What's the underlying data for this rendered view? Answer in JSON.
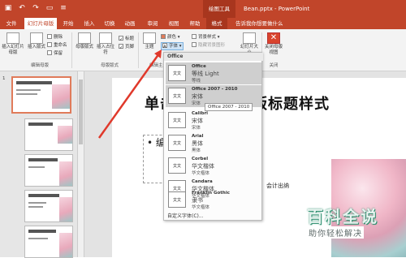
{
  "titlebar": {
    "context_label": "绘图工具",
    "document_title": "Bean.pptx - PowerPoint"
  },
  "tabs": [
    "文件",
    "幻灯片母版",
    "开始",
    "插入",
    "切换",
    "动画",
    "审阅",
    "视图",
    "帮助",
    "格式",
    "告诉我你想要做什么"
  ],
  "ribbon": {
    "insert_master": "插入幻灯片母版",
    "insert_layout": "插入版式",
    "delete": "删除",
    "rename": "重命名",
    "preserve": "保留",
    "master_layout": "母版版式",
    "insert_placeholder": "插入占位符",
    "title_check": "标题",
    "footer_check": "页脚",
    "theme": "主题",
    "colors": "颜色",
    "fonts": "字体",
    "bg_styles": "背景样式",
    "hide_bg": "隐藏背景图形",
    "slide_size": "幻灯片大小",
    "close_master": "关闭母版视图",
    "group_edit_master": "编辑母版",
    "group_layout": "母版版式",
    "group_edit_theme": "编辑主题",
    "group_close": "关闭"
  },
  "slides": [
    {
      "num": "1"
    },
    {
      "num": ""
    },
    {
      "num": ""
    },
    {
      "num": ""
    },
    {
      "num": ""
    }
  ],
  "slide": {
    "title": "单击此处编辑母版标题样式",
    "body": "• 编辑",
    "side_text": "会计出纳"
  },
  "font_menu": {
    "header": "Office",
    "tooltip": "Office 2007 - 2010",
    "sample_box": "文文",
    "custom": "自定义字体(C)...",
    "items": [
      {
        "name": "Office",
        "heading": "等线 Light",
        "body": "等线",
        "highlighted": true
      },
      {
        "name": "Office 2007 - 2010",
        "heading": "宋体",
        "body": "宋体",
        "highlighted": true
      },
      {
        "name": "Calibri",
        "heading": "宋体",
        "body": "宋体",
        "highlighted": false
      },
      {
        "name": "Arial",
        "heading": "黑体",
        "body": "黑体",
        "highlighted": false
      },
      {
        "name": "Corbel",
        "heading": "华文楷体",
        "body": "华文楷体",
        "highlighted": false
      },
      {
        "name": "Candara",
        "heading": "华文楷体",
        "body": "华文楷体",
        "highlighted": false
      },
      {
        "name": "Franklin Gothic",
        "heading": "隶书",
        "body": "华文楷体",
        "highlighted": false
      }
    ]
  },
  "watermark": {
    "line1": "百科全说",
    "line2": "助你轻松解决"
  },
  "colors": {
    "accent": "#c1452a",
    "arrow": "#e0392b",
    "watermark_green": "#2a8d6c"
  }
}
